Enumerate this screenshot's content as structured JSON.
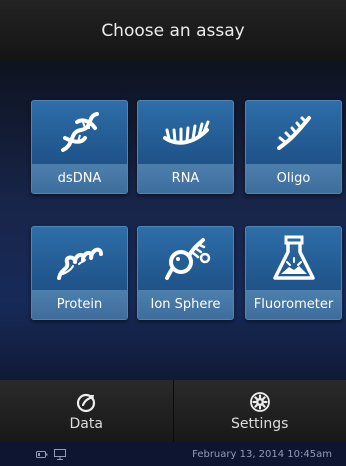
{
  "header": {
    "title": "Choose an assay"
  },
  "assays": [
    {
      "label": "dsDNA",
      "icon": "dsdna-helix-icon"
    },
    {
      "label": "RNA",
      "icon": "rna-strand-icon"
    },
    {
      "label": "Oligo",
      "icon": "oligo-strand-icon"
    },
    {
      "label": "Protein",
      "icon": "protein-coil-icon"
    },
    {
      "label": "Ion Sphere",
      "icon": "ion-sphere-icon"
    },
    {
      "label": "Fluorometer",
      "icon": "flask-icon"
    }
  ],
  "nav": {
    "data_label": "Data",
    "settings_label": "Settings"
  },
  "status": {
    "datetime": "February 13, 2014 10:45am"
  }
}
